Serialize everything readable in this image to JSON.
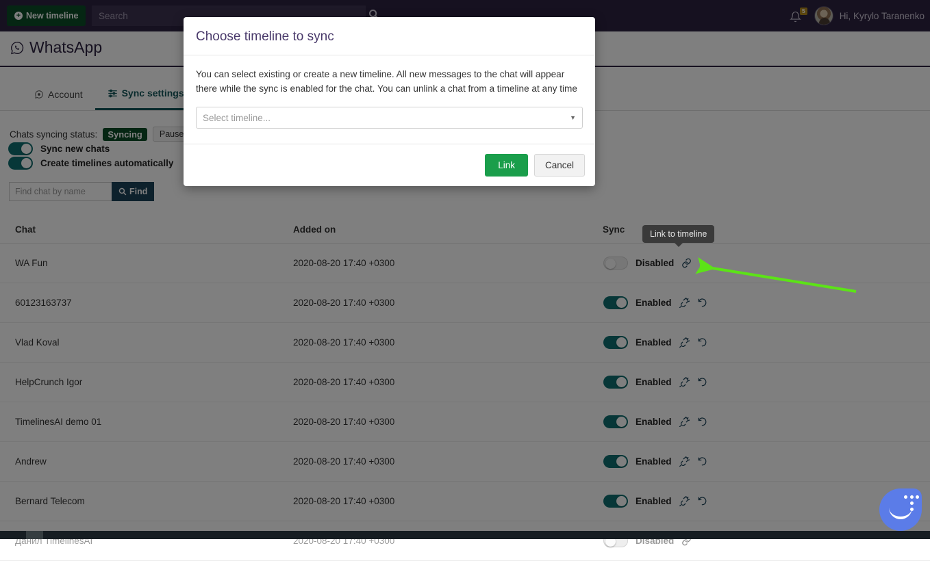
{
  "navbar": {
    "new_timeline_label": "New timeline",
    "search_placeholder": "Search",
    "notification_count": "5",
    "greeting": "Hi, Kyrylo Taranenko"
  },
  "page": {
    "title": "WhatsApp"
  },
  "tabs": [
    {
      "label": "Account",
      "active": false
    },
    {
      "label": "Sync settings",
      "active": true
    }
  ],
  "sync_controls": {
    "status_label": "Chats syncing status:",
    "status_value": "Syncing",
    "pause_label": "Pause",
    "toggles": [
      {
        "label": "Sync new chats",
        "state": "on"
      },
      {
        "label": "Create timelines automatically",
        "state": "on"
      }
    ],
    "find_placeholder": "Find chat by name",
    "find_button_label": "Find"
  },
  "table": {
    "columns": [
      "Chat",
      "Added on",
      "Sync"
    ],
    "rows": [
      {
        "chat": "WA Fun",
        "added_on": "2020-08-20 17:40 +0300",
        "sync_state": "off",
        "sync_label": "Disabled",
        "icons": [
          "link-icon"
        ],
        "dim": false
      },
      {
        "chat": "60123163737",
        "added_on": "2020-08-20 17:40 +0300",
        "sync_state": "on",
        "sync_label": "Enabled",
        "icons": [
          "unlink-icon",
          "history-icon"
        ],
        "dim": false
      },
      {
        "chat": "Vlad Koval",
        "added_on": "2020-08-20 17:40 +0300",
        "sync_state": "on",
        "sync_label": "Enabled",
        "icons": [
          "unlink-icon",
          "history-icon"
        ],
        "dim": false
      },
      {
        "chat": "HelpCrunch Igor",
        "added_on": "2020-08-20 17:40 +0300",
        "sync_state": "on",
        "sync_label": "Enabled",
        "icons": [
          "unlink-icon",
          "history-icon"
        ],
        "dim": false
      },
      {
        "chat": "TimelinesAI demo 01",
        "added_on": "2020-08-20 17:40 +0300",
        "sync_state": "on",
        "sync_label": "Enabled",
        "icons": [
          "unlink-icon",
          "history-icon"
        ],
        "dim": false
      },
      {
        "chat": "Andrew",
        "added_on": "2020-08-20 17:40 +0300",
        "sync_state": "on",
        "sync_label": "Enabled",
        "icons": [
          "unlink-icon",
          "history-icon"
        ],
        "dim": false
      },
      {
        "chat": "Bernard Telecom",
        "added_on": "2020-08-20 17:40 +0300",
        "sync_state": "on",
        "sync_label": "Enabled",
        "icons": [
          "unlink-icon",
          "history-icon"
        ],
        "dim": false
      },
      {
        "chat": "Данил TimelinesAI",
        "added_on": "2020-08-20 17:40 +0300",
        "sync_state": "off",
        "sync_label": "Disabled",
        "icons": [
          "link-icon"
        ],
        "dim": true
      }
    ]
  },
  "tooltip": {
    "text": "Link to timeline"
  },
  "modal": {
    "title": "Choose timeline to sync",
    "description": "You can select existing or create a new timeline. All new messages to the chat will appear there while the sync is enabled for the chat. You can unlink a chat from a timeline at any time",
    "select_placeholder": "Select timeline...",
    "primary_label": "Link",
    "secondary_label": "Cancel"
  },
  "widgets": {
    "chat_bubble": "intercom-chat-icon"
  },
  "colors": {
    "navbar": "#2d2240",
    "brand_purple": "#4a3a6b",
    "accent_teal": "#14575a",
    "green_badge": "#0b4d26",
    "green_button": "#1a9e4b",
    "toggle_on": "#0f6f70",
    "annotation_arrow": "#5ce317"
  }
}
